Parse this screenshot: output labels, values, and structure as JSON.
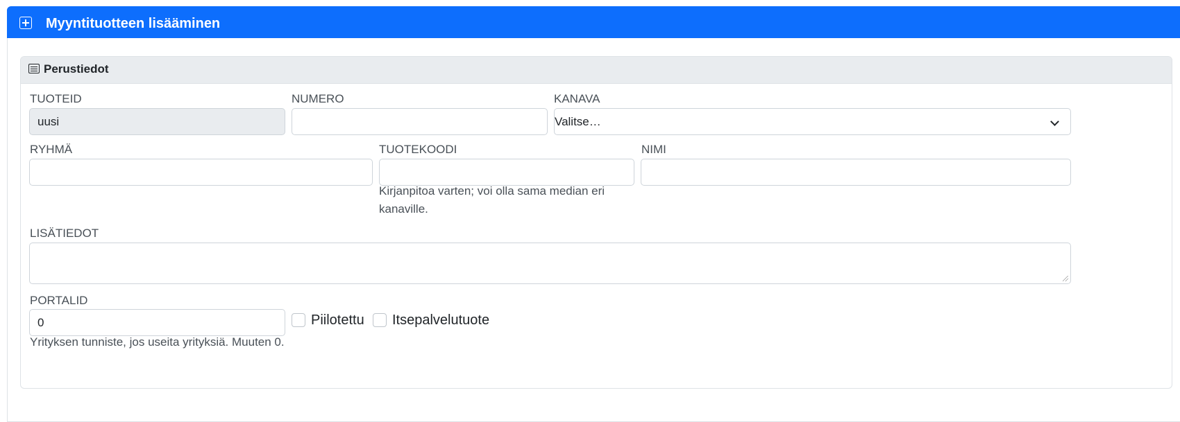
{
  "header": {
    "title": "Myyntituotteen lisääminen",
    "icon": "plus-square-icon"
  },
  "section": {
    "title": "Perustiedot",
    "icon": "card-text-icon"
  },
  "fields": {
    "tuoteid": {
      "label": "TUOTEID",
      "value": "uusi"
    },
    "numero": {
      "label": "NUMERO",
      "value": ""
    },
    "kanava": {
      "label": "KANAVA",
      "selected": "Valitse…"
    },
    "ryhma": {
      "label": "RYHMÄ",
      "value": ""
    },
    "tuotekoodi": {
      "label": "TUOTEKOODI",
      "value": "",
      "hint": "Kirjanpitoa varten; voi olla sama median eri kanaville."
    },
    "nimi": {
      "label": "NIMI",
      "value": ""
    },
    "lisatiedot": {
      "label": "LISÄTIEDOT",
      "value": ""
    },
    "portalid": {
      "label": "PORTALID",
      "value": "0",
      "hint": "Yrityksen tunniste, jos useita yrityksiä. Muuten 0."
    }
  },
  "checkboxes": {
    "piilotettu": {
      "label": "Piilotettu",
      "checked": false
    },
    "itsepalvelu": {
      "label": "Itsepalvelutuote",
      "checked": false
    }
  },
  "colors": {
    "primary": "#0d6efd",
    "card_header": "#e9ecef",
    "border": "#ced4da"
  }
}
